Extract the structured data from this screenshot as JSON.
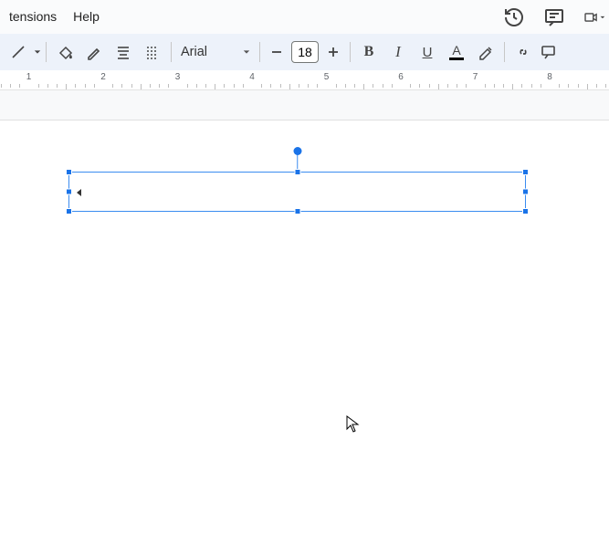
{
  "menubar": {
    "items": [
      "tensions",
      "Help"
    ]
  },
  "toolbar": {
    "font_name": "Arial",
    "font_size": "18"
  },
  "ruler": {
    "labels": [
      "1",
      "2",
      "3",
      "4",
      "5",
      "6",
      "7",
      "8"
    ]
  },
  "icons": {
    "history": "history-icon",
    "comment": "comment-icon",
    "video": "video-icon",
    "line": "line-icon",
    "paint_bucket": "paint-bucket-icon",
    "pen": "pen-icon",
    "para_center": "paragraph-align-icon",
    "para_spacing": "paragraph-spacing-icon",
    "minus": "decrease-font-icon",
    "plus": "increase-font-icon",
    "bold": "B",
    "italic": "I",
    "underline": "U",
    "text_color": "A",
    "link": "link-icon",
    "more": "more-icon"
  }
}
